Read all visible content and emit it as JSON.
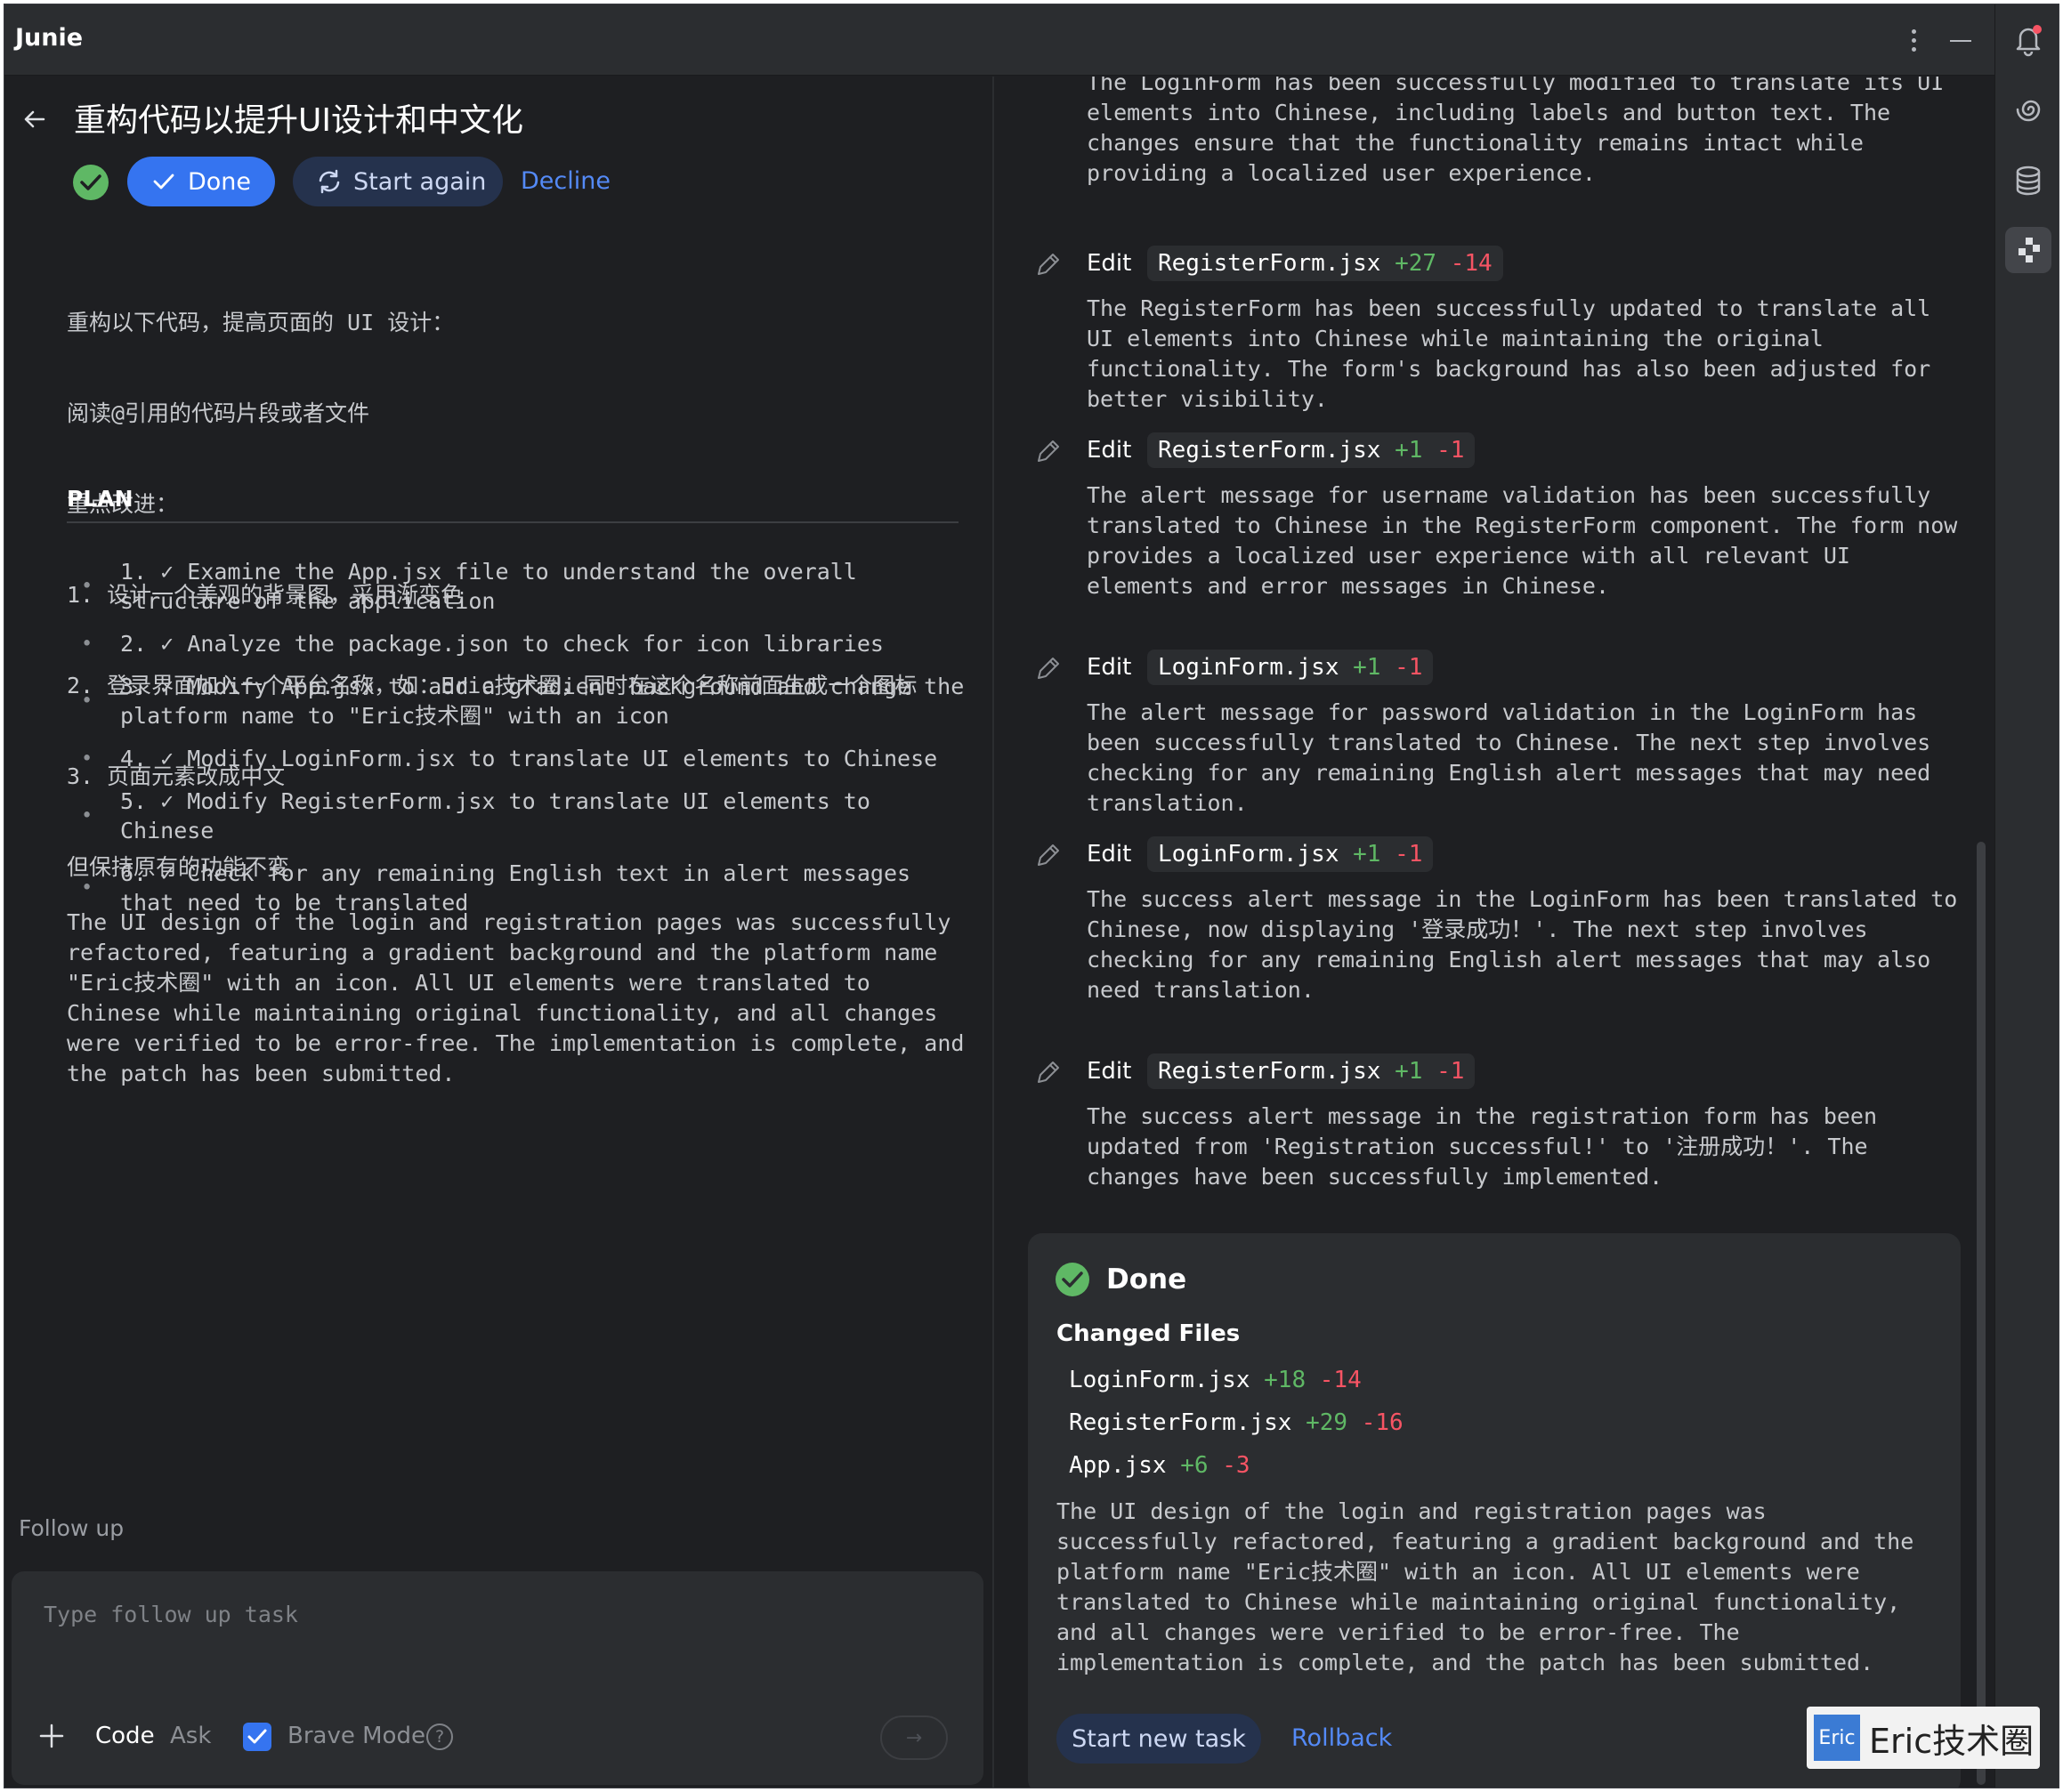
{
  "app": {
    "title": "Junie"
  },
  "task": {
    "title": "重构代码以提升UI设计和中文化",
    "done_label": "Done",
    "start_again_label": "Start again",
    "decline_label": "Decline"
  },
  "prompt": {
    "lines": [
      "重构以下代码，提高页面的 UI 设计：",
      "阅读@引用的代码片段或者文件",
      "重点改进：",
      "1. 设计一个美观的背景图，采用渐变色",
      "2. 登录界面加入一个平台名称，如：Eric技术圈，同时在这个名称前面生成一个图标",
      "3. 页面元素改成中文",
      "但保持原有的功能不变"
    ]
  },
  "plan": {
    "heading": "PLAN",
    "check": "✓",
    "items": [
      {
        "num": "1.",
        "text": "Examine the App.jsx file to understand the overall structure of the application"
      },
      {
        "num": "2.",
        "text": "Analyze the package.json to check for icon libraries"
      },
      {
        "num": "3.",
        "text": "Modify App.jsx to add a gradient background and change the platform name to \"Eric技术圈\" with an icon"
      },
      {
        "num": "4.",
        "text": "Modify LoginForm.jsx to translate UI elements to Chinese"
      },
      {
        "num": "5.",
        "text": "Modify RegisterForm.jsx to translate UI elements to Chinese"
      },
      {
        "num": "6.",
        "text": "Check for any remaining English text in alert messages that need to be translated"
      }
    ]
  },
  "summary": "The UI design of the login and registration pages was successfully refactored, featuring a gradient background and the platform name \"Eric技术圈\" with an icon. All UI elements were translated to Chinese while maintaining original functionality, and all changes were verified to be error-free. The implementation is complete, and the patch has been submitted.",
  "followup": {
    "label": "Follow up",
    "placeholder": "Type follow up task",
    "mode_code": "Code",
    "mode_ask": "Ask",
    "brave_mode_label": "Brave Mode",
    "brave_mode_checked": true,
    "help_glyph": "?",
    "send_glyph": "→"
  },
  "steps": {
    "top_text": "The LoginForm has been successfully modified to translate its UI elements into Chinese, including labels and button text. The changes ensure that the functionality remains intact while providing a localized user experience.",
    "items": [
      {
        "action": "Edit",
        "file": "RegisterForm.jsx",
        "added": "+27",
        "removed": "-14",
        "description": "The RegisterForm has been successfully updated to translate all UI elements into Chinese while maintaining the original functionality. The form's background has also been adjusted for better visibility."
      },
      {
        "action": "Edit",
        "file": "RegisterForm.jsx",
        "added": "+1",
        "removed": "-1",
        "description": "The alert message for username validation has been successfully translated to Chinese in the RegisterForm component. The form now provides a localized user experience with all relevant UI elements and error messages in Chinese."
      },
      {
        "action": "Edit",
        "file": "LoginForm.jsx",
        "added": "+1",
        "removed": "-1",
        "description": "The alert message for password validation in the LoginForm has been successfully translated to Chinese. The next step involves checking for any remaining English alert messages that may need translation."
      },
      {
        "action": "Edit",
        "file": "LoginForm.jsx",
        "added": "+1",
        "removed": "-1",
        "description": "The success alert message in the LoginForm has been translated to Chinese, now displaying '登录成功！'. The next step involves checking for any remaining English alert messages that may also need translation."
      },
      {
        "action": "Edit",
        "file": "RegisterForm.jsx",
        "added": "+1",
        "removed": "-1",
        "description": "The success alert message in the registration form has been updated from 'Registration successful!' to '注册成功！'. The changes have been successfully implemented."
      }
    ]
  },
  "done_card": {
    "title": "Done",
    "changed_files_heading": "Changed Files",
    "files": [
      {
        "name": "LoginForm.jsx",
        "added": "+18",
        "removed": "-14"
      },
      {
        "name": "RegisterForm.jsx",
        "added": "+29",
        "removed": "-16"
      },
      {
        "name": "App.jsx",
        "added": "+6",
        "removed": "-3"
      }
    ],
    "start_new_task_label": "Start new task",
    "rollback_label": "Rollback"
  },
  "watermark": {
    "logo_text": "Eric",
    "text": "Eric技术圈"
  },
  "icons": [
    "more-icon",
    "minimize-icon",
    "bell-icon",
    "spiral-icon",
    "database-icon",
    "junie-icon",
    "back-arrow-icon",
    "check-circle-icon",
    "refresh-icon",
    "pencil-icon",
    "plus-icon",
    "checkbox-icon",
    "help-icon",
    "send-icon"
  ],
  "colors": {
    "accent": "#3574f0",
    "link": "#548af7",
    "success": "#5fb865",
    "error": "#f75464",
    "background": "#1e1f22",
    "panel": "#2b2d30"
  }
}
